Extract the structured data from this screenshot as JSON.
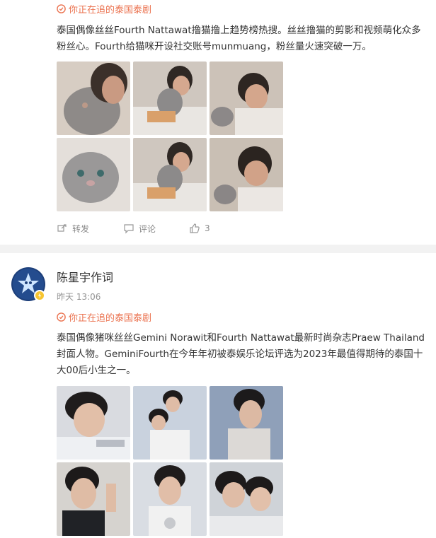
{
  "post1": {
    "topic": "你正在追的泰国泰剧",
    "text": "泰国偶像丝丝Fourth Nattawat撸猫撸上趋势榜热搜。丝丝撸猫的剪影和视频萌化众多粉丝心。Fourth给猫咪开设社交账号munmuang，粉丝量火速突破一万。",
    "actions": {
      "repost_label": "转发",
      "comment_label": "评论",
      "like_count": "3"
    }
  },
  "post2": {
    "username": "陈星宇作词",
    "time": "昨天 13:06",
    "topic": "你正在追的泰国泰剧",
    "text": "泰国偶像猪咪丝丝Gemini Norawit和Fourth Nattawat最新时尚杂志Praew Thailand封面人物。GeminiFourth在今年年初被泰娱乐论坛评选为2023年最值得期待的泰国十大00后小生之一。"
  },
  "colors": {
    "topic_accent": "#eb7350",
    "divider": "#f2f2f2",
    "verified_badge": "#f7c531"
  },
  "icons": {
    "topic": "topic-icon",
    "repost": "repost-icon",
    "comment": "comment-icon",
    "like": "like-icon",
    "verified": "verified-badge-icon"
  }
}
